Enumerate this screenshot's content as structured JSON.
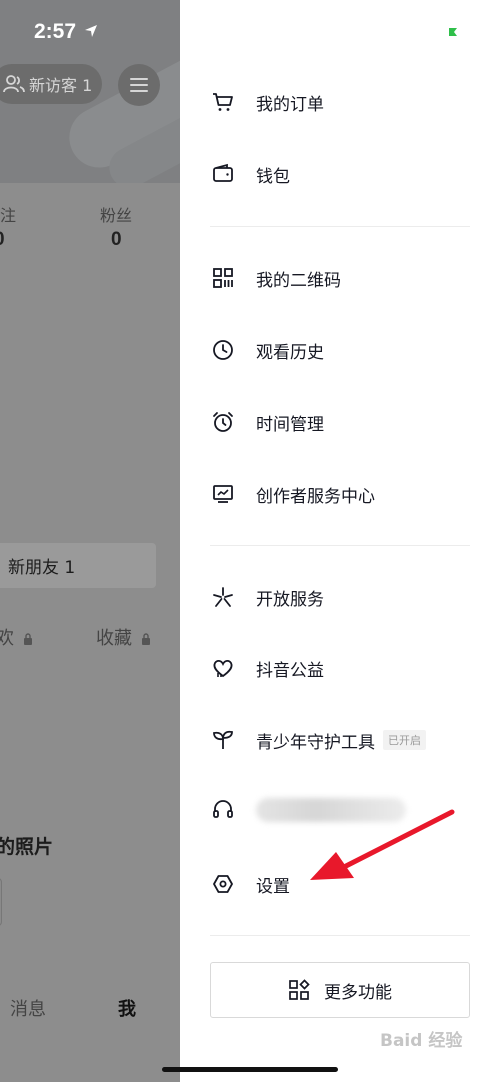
{
  "status_bar": {
    "time": "2:57"
  },
  "profile_bg": {
    "visitor_label": "新访客 1",
    "stats": [
      {
        "label": "注",
        "value": "0"
      },
      {
        "label": "粉丝",
        "value": "0"
      }
    ],
    "new_friend": "新朋友 1",
    "tabs": [
      {
        "label": "欢"
      },
      {
        "label": "收藏"
      }
    ],
    "photo_section_title": "的照片",
    "bottom_nav": {
      "messages": "消息",
      "me": "我"
    }
  },
  "drawer": {
    "groups": [
      [
        {
          "icon": "cart-icon",
          "label": "我的订单"
        },
        {
          "icon": "wallet-icon",
          "label": "钱包"
        }
      ],
      [
        {
          "icon": "qrcode-icon",
          "label": "我的二维码"
        },
        {
          "icon": "clock-icon",
          "label": "观看历史"
        },
        {
          "icon": "alarm-icon",
          "label": "时间管理"
        },
        {
          "icon": "monitor-chart-icon",
          "label": "创作者服务中心"
        }
      ],
      [
        {
          "icon": "sparkle-icon",
          "label": "开放服务"
        },
        {
          "icon": "heart-hands-icon",
          "label": "抖音公益"
        },
        {
          "icon": "sprout-icon",
          "label": "青少年守护工具",
          "badge": "已开启"
        },
        {
          "icon": "headset-icon",
          "label": ""
        },
        {
          "icon": "hexagon-settings-icon",
          "label": "设置"
        }
      ]
    ],
    "more_button": {
      "icon": "grid-apps-icon",
      "label": "更多功能"
    }
  },
  "watermark": "Baid 经验",
  "colors": {
    "accent_arrow": "#e8182b",
    "battery": "#2fbf4a"
  }
}
